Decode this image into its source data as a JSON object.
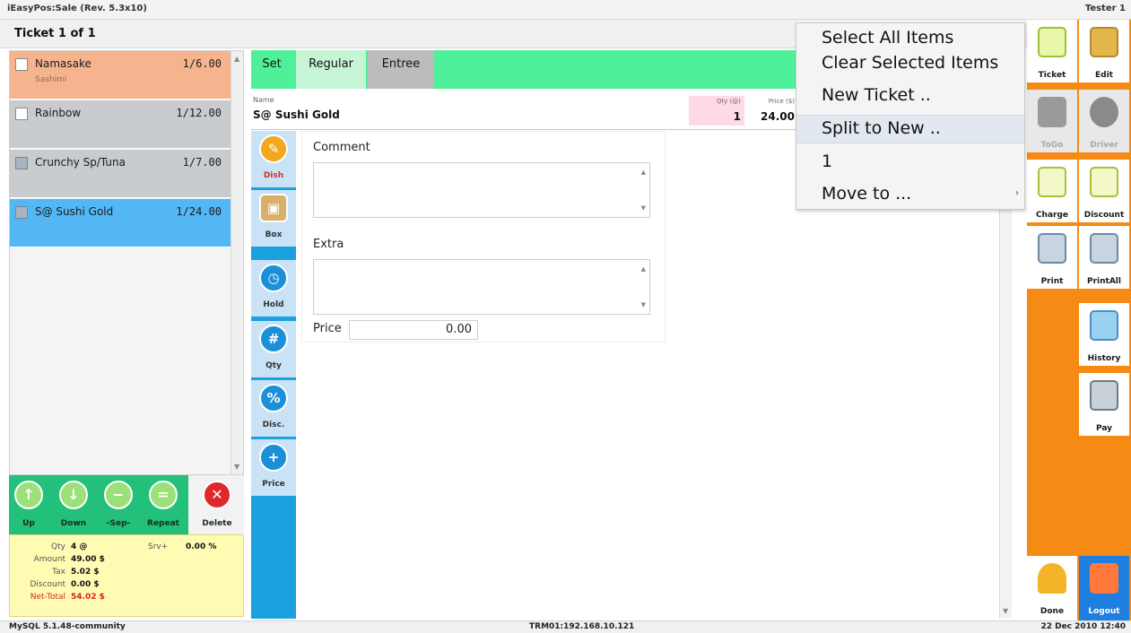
{
  "window": {
    "title": "iEasyPos:Sale (Rev. 5.3x10)",
    "user": "Tester 1"
  },
  "ticket_header": {
    "title": "Ticket 1 of 1"
  },
  "ticket_items": [
    {
      "name": "Namasake",
      "qty_price": "1/6.00",
      "sub": "Sashimi",
      "color": "#f6b48e"
    },
    {
      "name": "Rainbow",
      "qty_price": "1/12.00",
      "sub": "",
      "color": "#c8ccce"
    },
    {
      "name": "Crunchy Sp/Tuna",
      "qty_price": "1/7.00",
      "sub": "",
      "color": "#c8ccce"
    },
    {
      "name": "S@ Sushi Gold",
      "qty_price": "1/24.00",
      "sub": "",
      "color": "#54b7f5"
    }
  ],
  "action_buttons": [
    {
      "label": "Up"
    },
    {
      "label": "Down"
    },
    {
      "label": "-Sep-"
    },
    {
      "label": "Repeat"
    },
    {
      "label": "Delete"
    }
  ],
  "totals": {
    "qty_label": "Qty",
    "qty_value": "4 @",
    "srv_label": "Srv+",
    "srv_value": "0.00 %",
    "amount_label": "Amount",
    "amount_value": "49.00 $",
    "tax_label": "Tax",
    "tax_value": "5.02 $",
    "discount_label": "Discount",
    "discount_value": "0.00 $",
    "net_label": "Net-Total",
    "net_value": "54.02 $"
  },
  "tabs": [
    {
      "label": "Set"
    },
    {
      "label": "Regular"
    },
    {
      "label": "Entree"
    }
  ],
  "item_detail": {
    "name_label": "Name",
    "name_value": "S@ Sushi Gold",
    "qty_label": "Qty (@)",
    "qty_value": "1",
    "price_label": "Price ($)",
    "price_value": "24.00"
  },
  "side_buttons": [
    {
      "label": "Dish"
    },
    {
      "label": "Box"
    },
    {
      "label": "Hold"
    },
    {
      "label": "Qty"
    },
    {
      "label": "Disc."
    },
    {
      "label": "Price"
    }
  ],
  "form": {
    "comment_label": "Comment",
    "comment_value": "",
    "extra_label": "Extra",
    "extra_value": "",
    "price_label": "Price",
    "price_value": "0.00"
  },
  "right_buttons": [
    {
      "label": "Ticket"
    },
    {
      "label": "Edit"
    },
    {
      "label": "ToGo"
    },
    {
      "label": "Driver"
    },
    {
      "label": "Charge"
    },
    {
      "label": "Discount"
    },
    {
      "label": "Print"
    },
    {
      "label": "PrintAll"
    },
    {
      "label": "History"
    },
    {
      "label": "Pay"
    },
    {
      "label": "Done"
    },
    {
      "label": "Logout"
    }
  ],
  "context_menu": [
    {
      "label": "Select All Items"
    },
    {
      "label": "Clear Selected Items"
    },
    {
      "label": "New Ticket .."
    },
    {
      "label": "Split to New .."
    },
    {
      "label": "1"
    },
    {
      "label": "Move to ..."
    }
  ],
  "status": {
    "db": "MySQL 5.1.48-community",
    "terminal": "TRM01:192.168.10.121",
    "datetime": "22 Dec 2010 12:40"
  },
  "colors": {
    "accent_green": "#4ff09a",
    "accent_orange": "#f58a14",
    "accent_blue": "#1ba0e0"
  }
}
